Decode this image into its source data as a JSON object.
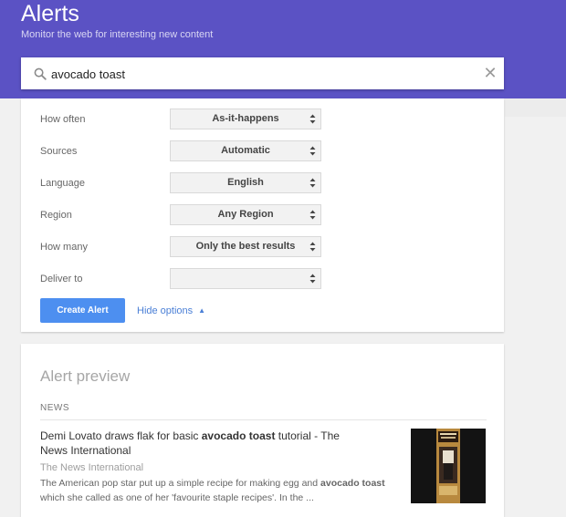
{
  "header": {
    "title": "Alerts",
    "subtitle": "Monitor the web for interesting new content",
    "brand_color": "#5b52c4"
  },
  "search": {
    "value": "avocado toast",
    "placeholder": "",
    "icon": "search-icon",
    "clear_icon": "close-icon"
  },
  "options": [
    {
      "label": "How often",
      "value": "As-it-happens"
    },
    {
      "label": "Sources",
      "value": "Automatic"
    },
    {
      "label": "Language",
      "value": "English"
    },
    {
      "label": "Region",
      "value": "Any Region"
    },
    {
      "label": "How many",
      "value": "Only the best results"
    },
    {
      "label": "Deliver to",
      "value": ""
    }
  ],
  "actions": {
    "create_label": "Create Alert",
    "hide_options_label": "Hide options",
    "accent_color": "#4d8ff0"
  },
  "preview": {
    "title": "Alert preview",
    "section_label": "NEWS",
    "article": {
      "title_pre": "Demi Lovato draws flak for basic ",
      "title_bold": "avocado toast",
      "title_post": " tutorial - The News International",
      "source": "The News International",
      "snippet_pre": "The American pop star put up a simple recipe for making egg and ",
      "snippet_bold": "avocado toast",
      "snippet_post": " which she called as one of her 'favourite staple recipes'. In the ..."
    }
  }
}
